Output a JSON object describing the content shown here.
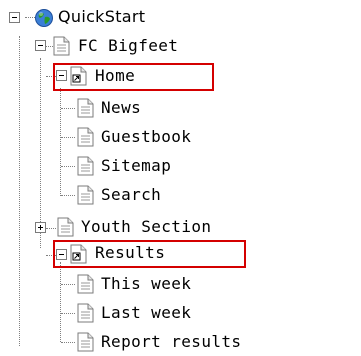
{
  "tree": {
    "root": {
      "label": "QuickStart",
      "icon": "globe-icon"
    },
    "site": {
      "label": "FC Bigfeet",
      "icon": "page-icon"
    },
    "home": {
      "label": "Home",
      "icon": "shortcut-page-icon",
      "children": [
        "News",
        "Guestbook",
        "Sitemap",
        "Search"
      ]
    },
    "youth": {
      "label": "Youth Section",
      "icon": "page-icon"
    },
    "results": {
      "label": "Results",
      "icon": "shortcut-page-icon",
      "children": [
        "This week",
        "Last week",
        "Report results"
      ]
    }
  },
  "colors": {
    "highlight": "#d40000",
    "globe": "#2a9a2a"
  }
}
